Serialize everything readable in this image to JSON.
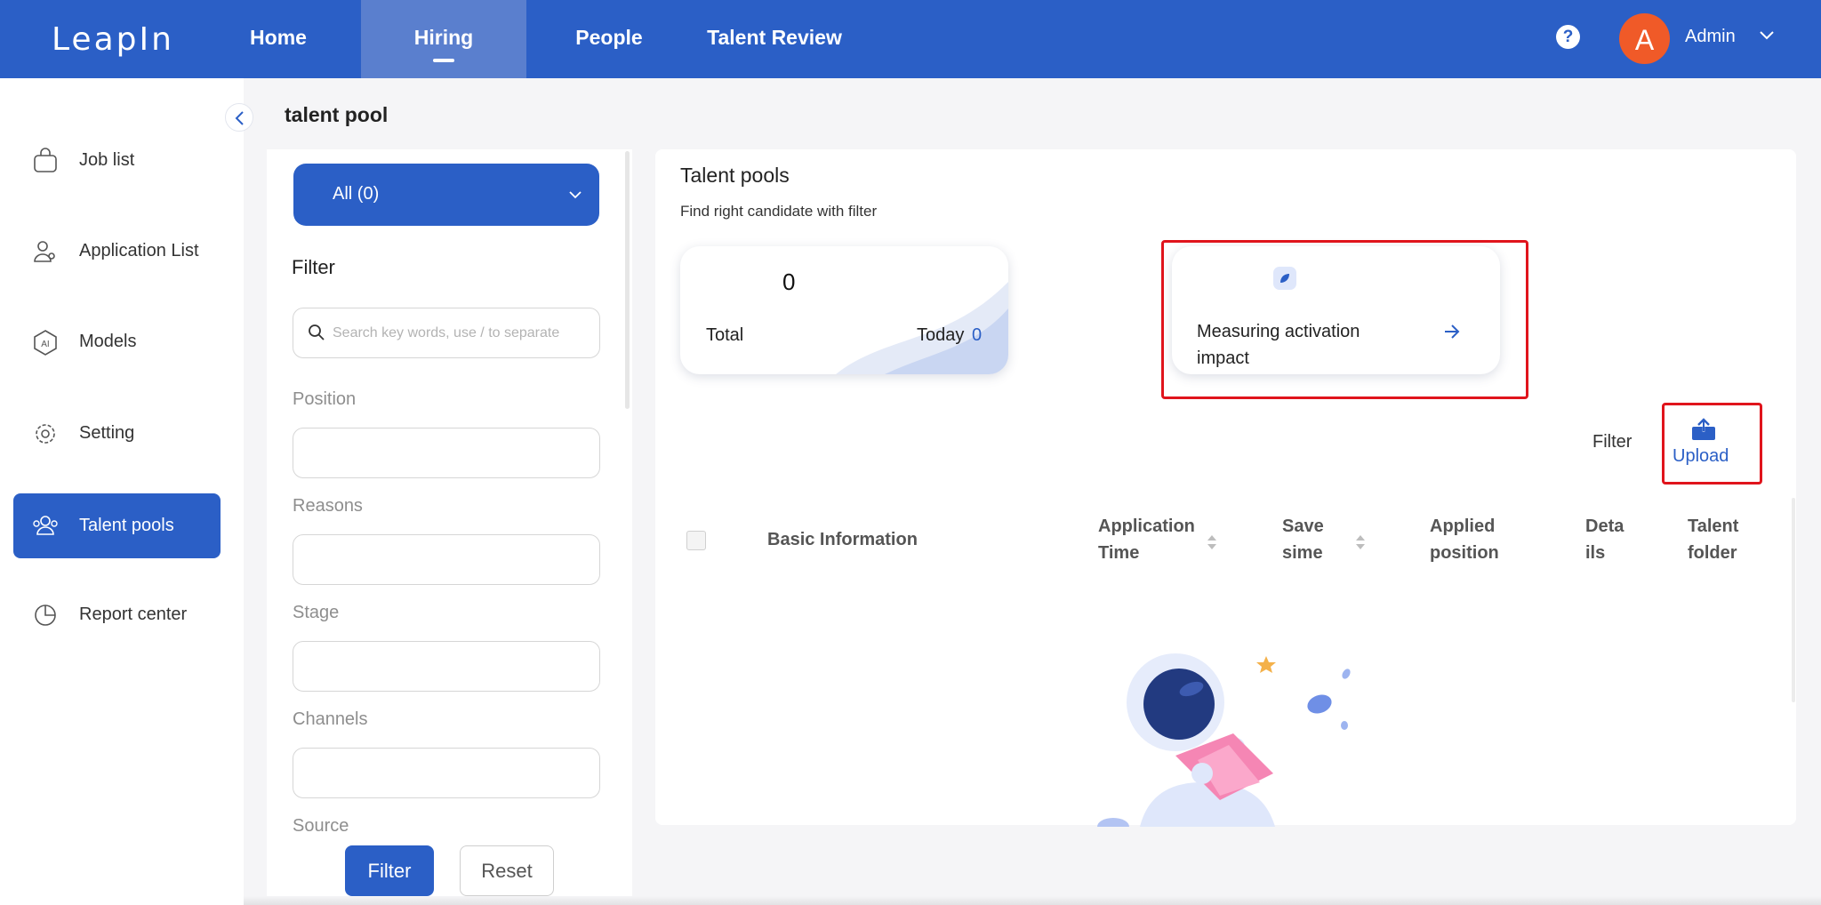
{
  "app": {
    "logo": "LeapIn"
  },
  "topnav": {
    "items": [
      {
        "label": "Home"
      },
      {
        "label": "Hiring"
      },
      {
        "label": "People"
      },
      {
        "label": "Talent Review"
      }
    ],
    "help": "?",
    "avatar_letter": "A",
    "user": "Admin"
  },
  "sidebar": {
    "items": [
      {
        "label": "Job list",
        "icon": "briefcase-icon"
      },
      {
        "label": "Application List",
        "icon": "users-icon"
      },
      {
        "label": "Models",
        "icon": "ai-model-icon"
      },
      {
        "label": "Setting",
        "icon": "gear-icon"
      },
      {
        "label": "Talent pools",
        "icon": "talent-pool-icon"
      },
      {
        "label": "Report center",
        "icon": "pie-chart-icon"
      }
    ]
  },
  "page": {
    "title": "talent pool"
  },
  "filter_panel": {
    "all_select": "All (0)",
    "heading": "Filter",
    "search_placeholder": "Search key words, use / to separate",
    "fields": [
      {
        "label": "Position"
      },
      {
        "label": "Reasons"
      },
      {
        "label": "Stage"
      },
      {
        "label": "Channels"
      },
      {
        "label": "Source"
      }
    ],
    "filter_button": "Filter",
    "reset_button": "Reset"
  },
  "main": {
    "title": "Talent pools",
    "subtitle": "Find right candidate with filter",
    "stats": {
      "total_value": "0",
      "total_label": "Total",
      "today_label": "Today",
      "today_value": "0"
    },
    "measure_card": {
      "text": "Measuring activation impact"
    },
    "toolbar": {
      "filter": "Filter",
      "upload": "Upload"
    },
    "table": {
      "columns": [
        {
          "label": "Basic Information"
        },
        {
          "label": "Application Time"
        },
        {
          "label": "Save sime"
        },
        {
          "label": "Applied position"
        },
        {
          "label": "Deta ils"
        },
        {
          "label": "Talent folder"
        }
      ]
    }
  },
  "colors": {
    "brand": "#2b5fc6",
    "highlight": "#e0141c",
    "avatar": "#f05a28"
  }
}
